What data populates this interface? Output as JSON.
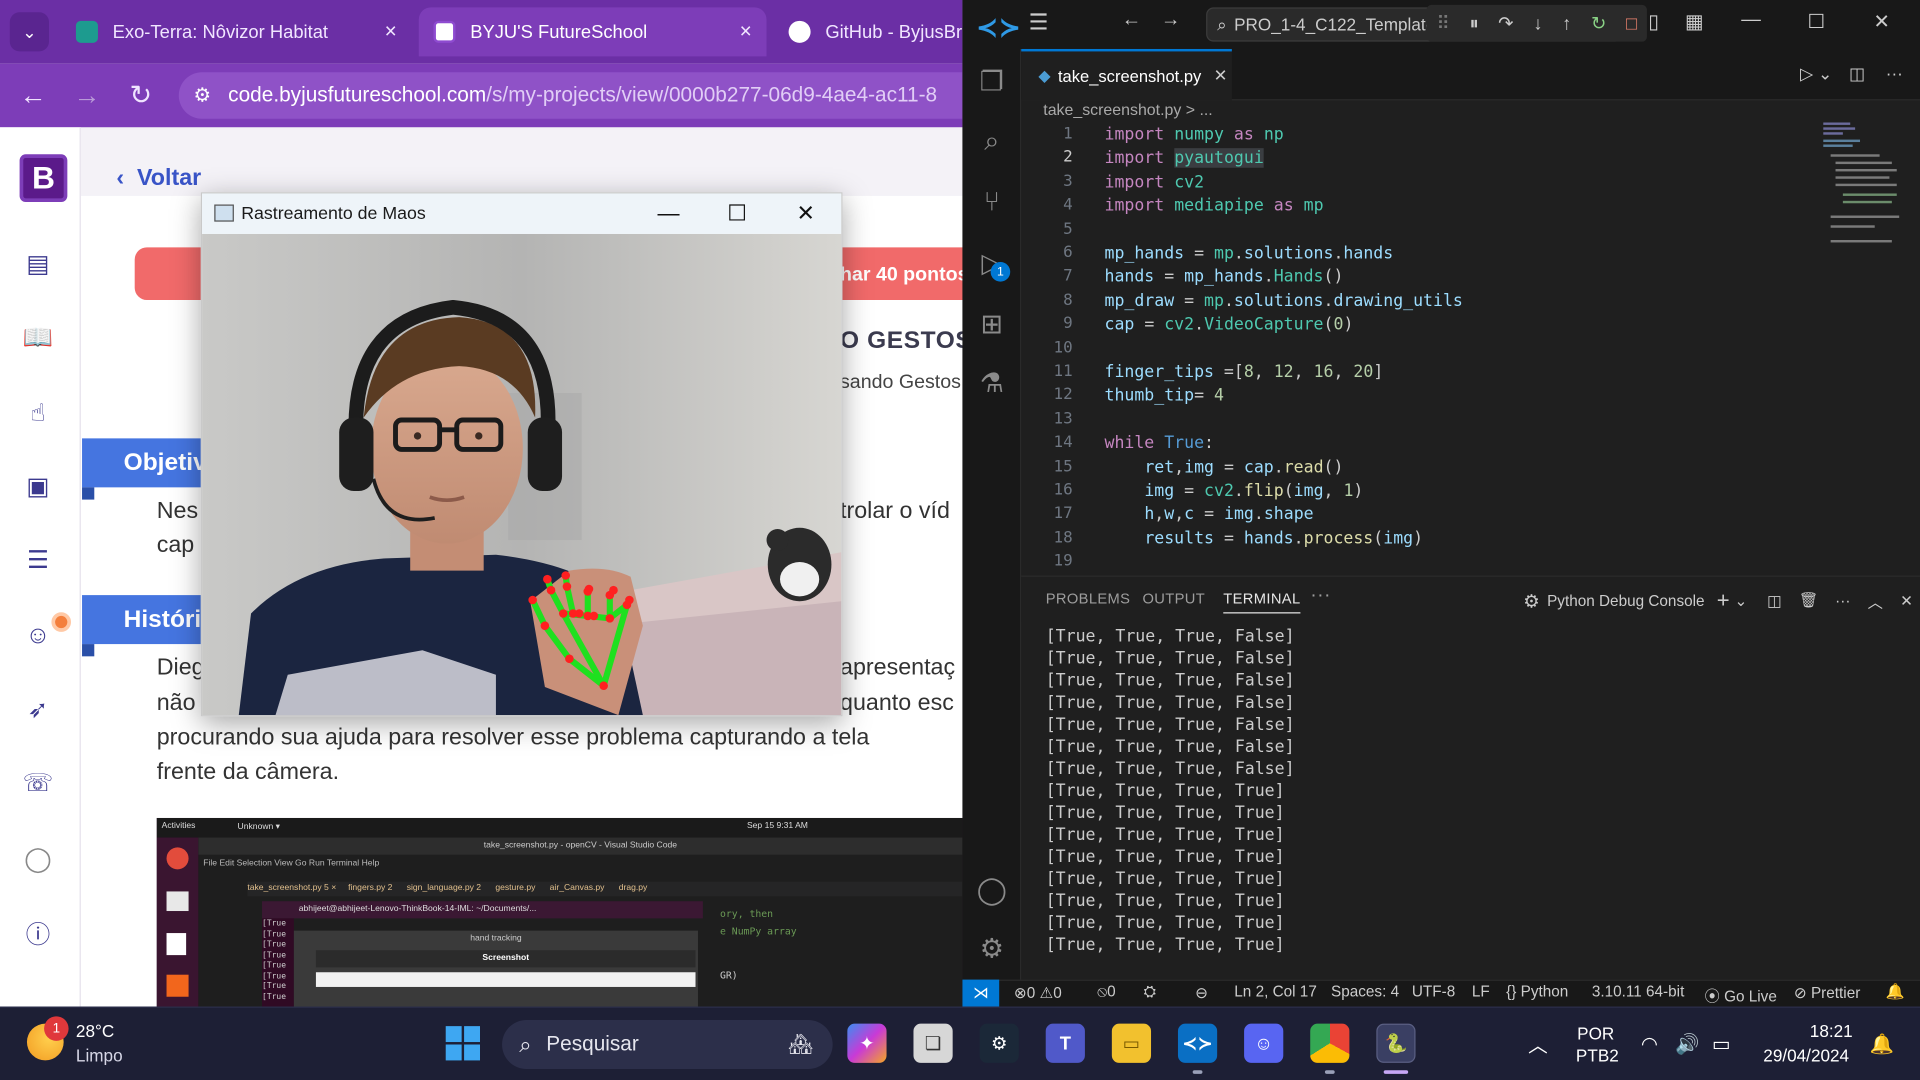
{
  "browser": {
    "tabs": [
      {
        "label": "Exo-Terra: Nôvizor Habitat",
        "close": "×"
      },
      {
        "label": "BYJU'S FutureSchool",
        "close": "×"
      },
      {
        "label": "GitHub - ByjusBra"
      }
    ],
    "url_host": "code.byjusfutureschool.com",
    "url_path": "/s/my-projects/view/0000b277-06d9-4ae4-ac11-8"
  },
  "page": {
    "back_label": "Voltar",
    "points_text": "har 40 pontos",
    "project_title": "O GESTOS",
    "project_subtitle": "sando Gestos",
    "objective_heading": "Objetiv",
    "objective_line1_left": "Nes",
    "objective_line1_right": "trolar o víd",
    "objective_line2": "cap",
    "history_heading": "Históri",
    "history_line1_left": "Dieg",
    "history_line1_right": "apresentaç",
    "history_line2_left": "não",
    "history_line2_right": "quanto esc",
    "history_line3": "procurando sua ajuda para resolver esse problema capturando a tela",
    "history_line4": "frente da câmera."
  },
  "embedded": {
    "activities": "Activities",
    "unknown": "Unknown ▾",
    "clock": "Sep 15  9:31 AM",
    "window_title": "take_screenshot.py - openCV - Visual Studio Code",
    "menu": "File  Edit  Selection  View  Go  Run  Terminal  Help",
    "tabs": "take_screenshot.py 5 ×     fingers.py 2      sign_language.py 2      gesture.py      air_Canvas.py      drag.py",
    "terminal_title": "abhijeet@abhijeet-Lenovo-ThinkBook-14-IML: ~/Documents/...",
    "hand_tracking": "hand tracking",
    "screenshot": "Screenshot",
    "code_hint1": "ory, then",
    "code_hint2": "e NumPy array",
    "code_hint3": "GR)",
    "term_rows": [
      "[True",
      "[True",
      "[True",
      "[True",
      "[True",
      "[True",
      "[True",
      "[True"
    ]
  },
  "cv_window": {
    "title": "Rastreamento de Maos",
    "minimize": "—",
    "maximize": "☐",
    "close": "✕"
  },
  "vscode": {
    "search": "PRO_1-4_C122_Template",
    "tab_label": "take_screenshot.py",
    "breadcrumb": "take_screenshot.py > ...",
    "line_numbers": [
      "1",
      "2",
      "3",
      "4",
      "5",
      "6",
      "7",
      "8",
      "9",
      "10",
      "11",
      "12",
      "13",
      "14",
      "15",
      "16",
      "17",
      "18",
      "19"
    ],
    "panel_tabs": {
      "problems": "PROBLEMS",
      "output": "OUTPUT",
      "terminal": "TERMINAL",
      "more": "···"
    },
    "console_label": "Python Debug Console",
    "terminal_lines": [
      "[True, True, True, False]",
      "[True, True, True, False]",
      "[True, True, True, False]",
      "[True, True, True, False]",
      "[True, True, True, False]",
      "[True, True, True, False]",
      "[True, True, True, False]",
      "[True, True, True, True]",
      "[True, True, True, True]",
      "[True, True, True, True]",
      "[True, True, True, True]",
      "[True, True, True, True]",
      "[True, True, True, True]",
      "[True, True, True, True]",
      "[True, True, True, True]"
    ],
    "debug_badge": "1",
    "status": {
      "errors": "⊗0 ⚠0",
      "ports": "⦸0",
      "position": "Ln 2, Col 17",
      "spaces": "Spaces: 4",
      "encoding": "UTF-8",
      "eol": "LF",
      "language": "{} Python",
      "interpreter": "3.10.11 64-bit",
      "golive": "Go Live",
      "prettier": "Prettier"
    }
  },
  "taskbar": {
    "weather_badge": "1",
    "temperature": "28°C",
    "condition": "Limpo",
    "search_placeholder": "Pesquisar",
    "lang_line1": "POR",
    "lang_line2": "PTB2",
    "time": "18:21",
    "date": "29/04/2024"
  },
  "colors": {
    "browser_accent": "#7d3db8",
    "ribbon_blue": "#4575e0",
    "points_pill": "#f16a6a",
    "vscode_accent": "#0078d4",
    "hand_landmark": "#ff2020",
    "hand_connection": "#1fe01f"
  }
}
